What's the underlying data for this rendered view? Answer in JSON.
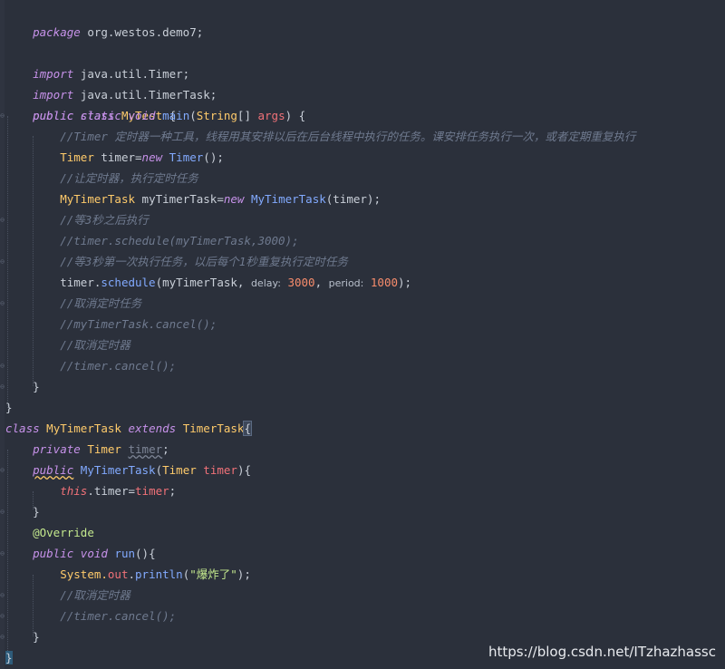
{
  "code": {
    "l1_pkg_kw": "package",
    "l1_pkg_name": " org.westos.demo7;",
    "l3_import_kw": "import",
    "l3_import": " java.util.Timer;",
    "l4_import_kw": "import",
    "l4_import": " java.util.TimerTask;",
    "l5_public": "public",
    "l5_class": "class",
    "l5_name": "MyTest",
    "l5_brace": " {",
    "l6_public": "public",
    "l6_static": "static",
    "l6_void": "void",
    "l6_main": "main",
    "l6_open": "(",
    "l6_string": "String",
    "l6_arr": "[] ",
    "l6_args": "args",
    "l6_close": ") {",
    "l7_comment": "//Timer 定时器一种工具，线程用其安排以后在后台线程中执行的任务。课安排任务执行一次，或者定期重复执行",
    "l8_type": "Timer",
    "l8_var": " timer=",
    "l8_new": "new",
    "l8_ctor": "Timer",
    "l8_end": "();",
    "l9_comment": "//让定时器，执行定时任务",
    "l10_type": "MyTimerTask",
    "l10_var": " myTimerTask=",
    "l10_new": "new",
    "l10_ctor": "MyTimerTask",
    "l10_end": "(timer);",
    "l11_comment": "//等3秒之后执行",
    "l12_comment": "//timer.schedule(myTimerTask,3000);",
    "l13_comment": "//等3秒第一次执行任务，以后每个1秒重复执行定时任务",
    "l14_obj": "timer.",
    "l14_method": "schedule",
    "l14_arg1": "(myTimerTask, ",
    "l14_hint_delay": "delay:",
    "l14_delay": "3000",
    "l14_comma": ", ",
    "l14_hint_period": "period:",
    "l14_period": "1000",
    "l14_end": ");",
    "l15_comment": "//取消定时任务",
    "l16_comment": "//myTimerTask.cancel();",
    "l17_comment": "//取消定时器",
    "l18_comment": "//timer.cancel();",
    "l19_brace": "}",
    "l20_brace": "}",
    "l21_class": "class",
    "l21_name": "MyTimerTask",
    "l21_extends": "extends",
    "l21_super": "TimerTask",
    "l21_brace": "{",
    "l22_private": "private",
    "l22_type": "Timer",
    "l22_field": "timer",
    "l22_end": ";",
    "l23_public": "public",
    "l23_ctor": "MyTimerTask",
    "l23_open": "(",
    "l23_type": "Timer",
    "l23_param": "timer",
    "l23_close": "){",
    "l24_this": "this",
    "l24_dot": ".timer=",
    "l24_val": "timer",
    "l24_end": ";",
    "l25_brace": "}",
    "l26_ann": "@Override",
    "l27_public": "public",
    "l27_void": "void",
    "l27_run": "run",
    "l27_end": "(){",
    "l28_sys": "System.",
    "l28_out": "out",
    "l28_dot": ".",
    "l28_println": "println",
    "l28_open": "(",
    "l28_str": "\"爆炸了\"",
    "l28_end": ");",
    "l29_comment": "//取消定时器",
    "l30_comment": "//timer.cancel();",
    "l31_brace": "}",
    "l32_brace": "}"
  },
  "watermark": "https://blog.csdn.net/ITzhazhassc",
  "colors": {
    "background": "#2b303b",
    "keyword": "#c792ea",
    "type": "#ffcb6b",
    "function": "#82aaff",
    "number": "#f78c6c",
    "string": "#c3e88d",
    "comment": "#6f7a8f",
    "param": "#f07178"
  },
  "icons": [
    "fold-icon"
  ]
}
